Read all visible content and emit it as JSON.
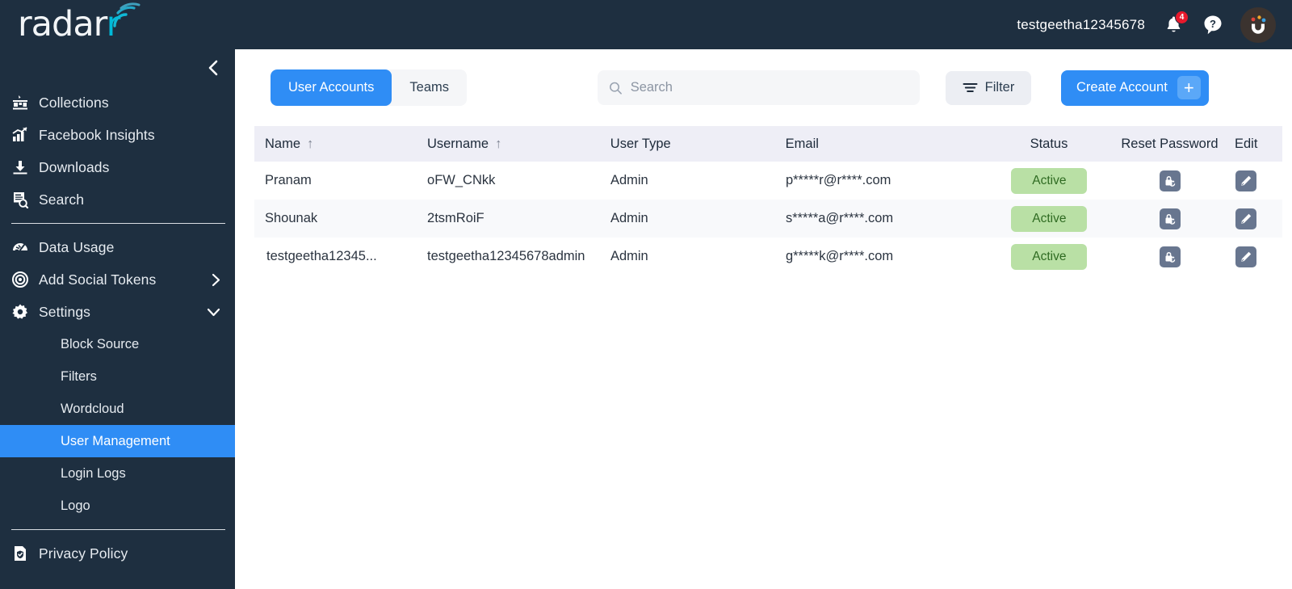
{
  "brand": {
    "name_part1": "radar",
    "name_part2": "r",
    "logo_icon": "radar-waves-icon"
  },
  "header": {
    "username": "testgeetha12345678",
    "notification_count": "4",
    "bell_icon": "bell-icon",
    "help_icon": "question-mark-icon",
    "avatar_icon": "user-avatar-icon"
  },
  "sidebar": {
    "collapse_icon": "chevron-left-icon",
    "items": [
      {
        "label": "Collections",
        "icon": "collections-icon",
        "caret": ""
      },
      {
        "label": "Facebook Insights",
        "icon": "insights-chart-icon",
        "caret": ""
      },
      {
        "label": "Downloads",
        "icon": "download-icon",
        "caret": ""
      },
      {
        "label": "Search",
        "icon": "search-document-icon",
        "caret": ""
      },
      {
        "label": "Data Usage",
        "icon": "gauge-icon",
        "caret": ""
      },
      {
        "label": "Add Social Tokens",
        "icon": "target-icon",
        "caret": "chevron-right-icon"
      },
      {
        "label": "Settings",
        "icon": "gear-icon",
        "caret": "chevron-down-icon"
      }
    ],
    "sub_items": [
      {
        "label": "Block Source",
        "active": false
      },
      {
        "label": "Filters",
        "active": false
      },
      {
        "label": "Wordcloud",
        "active": false
      },
      {
        "label": "User Management",
        "active": true
      },
      {
        "label": "Login Logs",
        "active": false
      },
      {
        "label": "Logo",
        "active": false
      }
    ],
    "footer_item": {
      "label": "Privacy Policy",
      "icon": "privacy-shield-doc-icon"
    },
    "active_color": "#2f8df5",
    "background_color": "#1e2f40"
  },
  "toolbar": {
    "tabs": [
      {
        "label": "User Accounts",
        "active": true
      },
      {
        "label": "Teams",
        "active": false
      }
    ],
    "search": {
      "placeholder": "Search",
      "value": "",
      "icon": "search-icon"
    },
    "filter": {
      "label": "Filter",
      "icon": "filter-icon"
    },
    "create": {
      "label": "Create Account",
      "icon": "plus-icon"
    }
  },
  "table": {
    "columns": [
      {
        "label": "Name",
        "sort": "↑"
      },
      {
        "label": "Username",
        "sort": "↑"
      },
      {
        "label": "User Type",
        "sort": ""
      },
      {
        "label": "Email",
        "sort": ""
      },
      {
        "label": "Status",
        "sort": ""
      },
      {
        "label": "Reset Password",
        "sort": ""
      },
      {
        "label": "Edit",
        "sort": ""
      }
    ],
    "rows": [
      {
        "name": "Pranam",
        "username": "oFW_CNkk",
        "user_type": "Admin",
        "email": "p*****r@r****.com",
        "status": "Active",
        "reset_icon": "lock-reset-icon",
        "edit_icon": "pencil-edit-icon"
      },
      {
        "name": "Shounak",
        "username": "2tsmRoiF",
        "user_type": "Admin",
        "email": "s*****a@r****.com",
        "status": "Active",
        "reset_icon": "lock-reset-icon",
        "edit_icon": "pencil-edit-icon"
      },
      {
        "name": "testgeetha12345...",
        "username": "testgeetha12345678admin",
        "user_type": "Admin",
        "email": "g*****k@r****.com",
        "status": "Active",
        "reset_icon": "lock-reset-icon",
        "edit_icon": "pencil-edit-icon"
      }
    ],
    "status_badge_bg": "#b9e0a5",
    "status_badge_text_color": "#2f6b22",
    "header_bg": "#eeeef6"
  }
}
